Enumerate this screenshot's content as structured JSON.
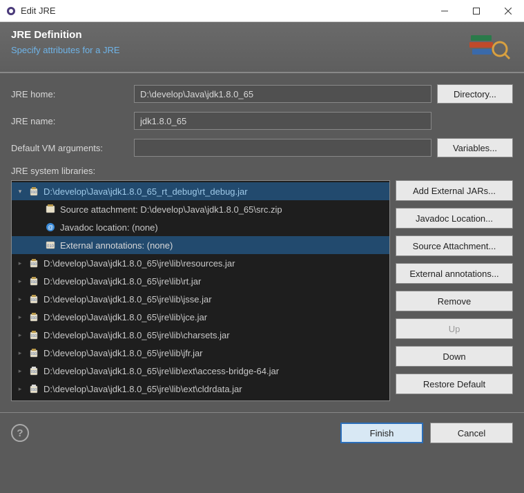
{
  "window": {
    "title": "Edit JRE"
  },
  "header": {
    "title": "JRE Definition",
    "subtitle": "Specify attributes for a JRE"
  },
  "form": {
    "jre_home_label": "JRE home:",
    "jre_home_value": "D:\\develop\\Java\\jdk1.8.0_65",
    "directory_btn": "Directory...",
    "jre_name_label": "JRE name:",
    "jre_name_value": "jdk1.8.0_65",
    "vm_args_label": "Default VM arguments:",
    "vm_args_value": "",
    "variables_btn": "Variables...",
    "libs_label": "JRE system libraries:"
  },
  "tree": {
    "items": [
      {
        "type": "jar-expanded",
        "label": "D:\\develop\\Java\\jdk1.8.0_65_rt_debug\\rt_debug.jar",
        "selected": true
      },
      {
        "type": "child-src",
        "label": "Source attachment: D:\\develop\\Java\\jdk1.8.0_65\\src.zip"
      },
      {
        "type": "child-doc",
        "label": "Javadoc location: (none)"
      },
      {
        "type": "child-ann",
        "label": "External annotations: (none)",
        "selected": true
      },
      {
        "type": "jar",
        "label": "D:\\develop\\Java\\jdk1.8.0_65\\jre\\lib\\resources.jar"
      },
      {
        "type": "jar",
        "label": "D:\\develop\\Java\\jdk1.8.0_65\\jre\\lib\\rt.jar"
      },
      {
        "type": "jar",
        "label": "D:\\develop\\Java\\jdk1.8.0_65\\jre\\lib\\jsse.jar"
      },
      {
        "type": "jar",
        "label": "D:\\develop\\Java\\jdk1.8.0_65\\jre\\lib\\jce.jar"
      },
      {
        "type": "jar",
        "label": "D:\\develop\\Java\\jdk1.8.0_65\\jre\\lib\\charsets.jar"
      },
      {
        "type": "jar",
        "label": "D:\\develop\\Java\\jdk1.8.0_65\\jre\\lib\\jfr.jar"
      },
      {
        "type": "jar-ext",
        "label": "D:\\develop\\Java\\jdk1.8.0_65\\jre\\lib\\ext\\access-bridge-64.jar"
      },
      {
        "type": "jar-ext",
        "label": "D:\\develop\\Java\\jdk1.8.0_65\\jre\\lib\\ext\\cldrdata.jar"
      }
    ]
  },
  "lib_buttons": {
    "add_external": "Add External JARs...",
    "javadoc": "Javadoc Location...",
    "source": "Source Attachment...",
    "annotations": "External annotations...",
    "remove": "Remove",
    "up": "Up",
    "down": "Down",
    "restore": "Restore Default"
  },
  "footer": {
    "finish": "Finish",
    "cancel": "Cancel"
  }
}
